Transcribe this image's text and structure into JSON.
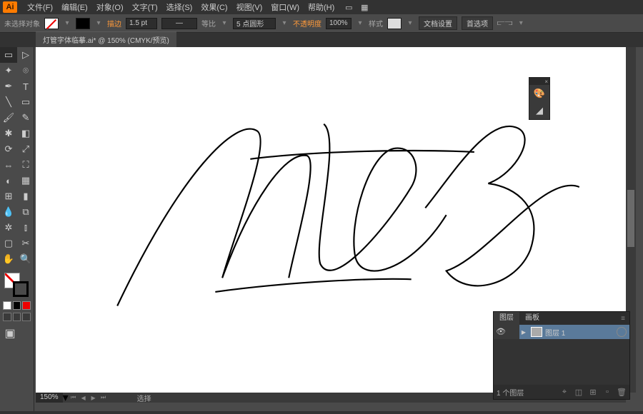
{
  "app": {
    "logo_text": "Ai"
  },
  "menu": {
    "file": "文件(F)",
    "edit": "编辑(E)",
    "object": "对象(O)",
    "type": "文字(T)",
    "select": "选择(S)",
    "effect": "效果(C)",
    "view": "视图(V)",
    "window": "窗口(W)",
    "help": "帮助(H)"
  },
  "control": {
    "no_selection": "未选择对象",
    "stroke_label": "描边",
    "stroke_weight": "1.5 pt",
    "dash_label": "等比",
    "brush_label": "5 点圆形",
    "opacity_label": "不透明度",
    "opacity_value": "100%",
    "style_label": "样式",
    "doc_setup": "文档设置",
    "preferences": "首选项"
  },
  "tab": {
    "title": "灯管字体临摹.ai* @ 150% (CMYK/预览)"
  },
  "status": {
    "zoom": "150%",
    "selection": "选择"
  },
  "layers": {
    "tab_layers": "图层",
    "tab_artboards": "画板",
    "row1_name": "图层 1",
    "footer_count": "1 个图层"
  }
}
